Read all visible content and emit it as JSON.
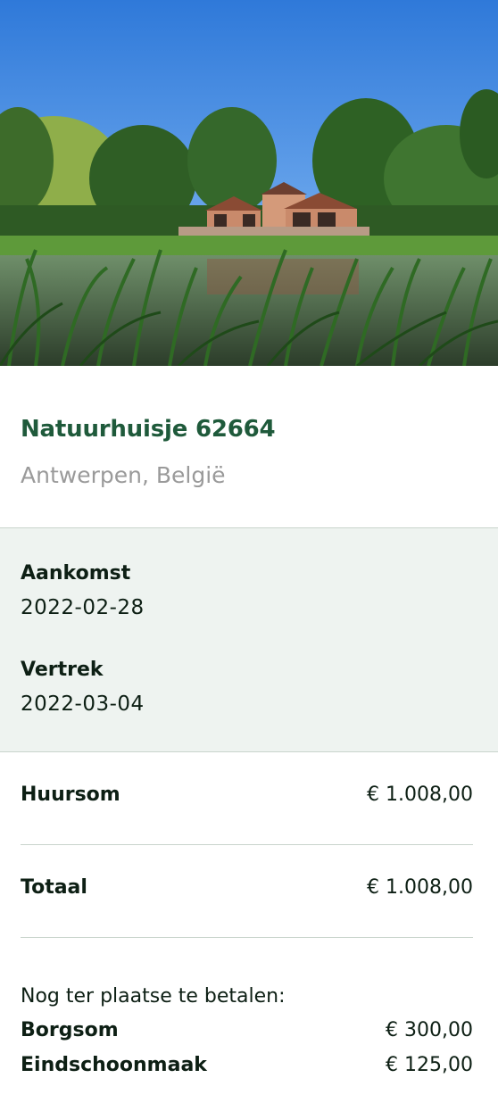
{
  "listing": {
    "image_alt": "Natuurhuisje aan een vijver",
    "title": "Natuurhuisje 62664",
    "location": "Antwerpen, België"
  },
  "dates": {
    "arrival_label": "Aankomst",
    "arrival_value": "2022-02-28",
    "departure_label": "Vertrek",
    "departure_value": "2022-03-04"
  },
  "pricing": {
    "rent_label": "Huursom",
    "rent_value": "€ 1.008,00",
    "total_label": "Totaal",
    "total_value": "€ 1.008,00"
  },
  "onsite": {
    "intro": "Nog ter plaatse te betalen:",
    "items": [
      {
        "label": "Borgsom",
        "value": "€ 300,00"
      },
      {
        "label": "Eindschoonmaak",
        "value": "€ 125,00"
      }
    ]
  },
  "colors": {
    "brand_green": "#1f5a3b",
    "muted_text": "#9a9a9a",
    "panel_bg": "#eef3f0",
    "divider": "#c9d4cc"
  }
}
